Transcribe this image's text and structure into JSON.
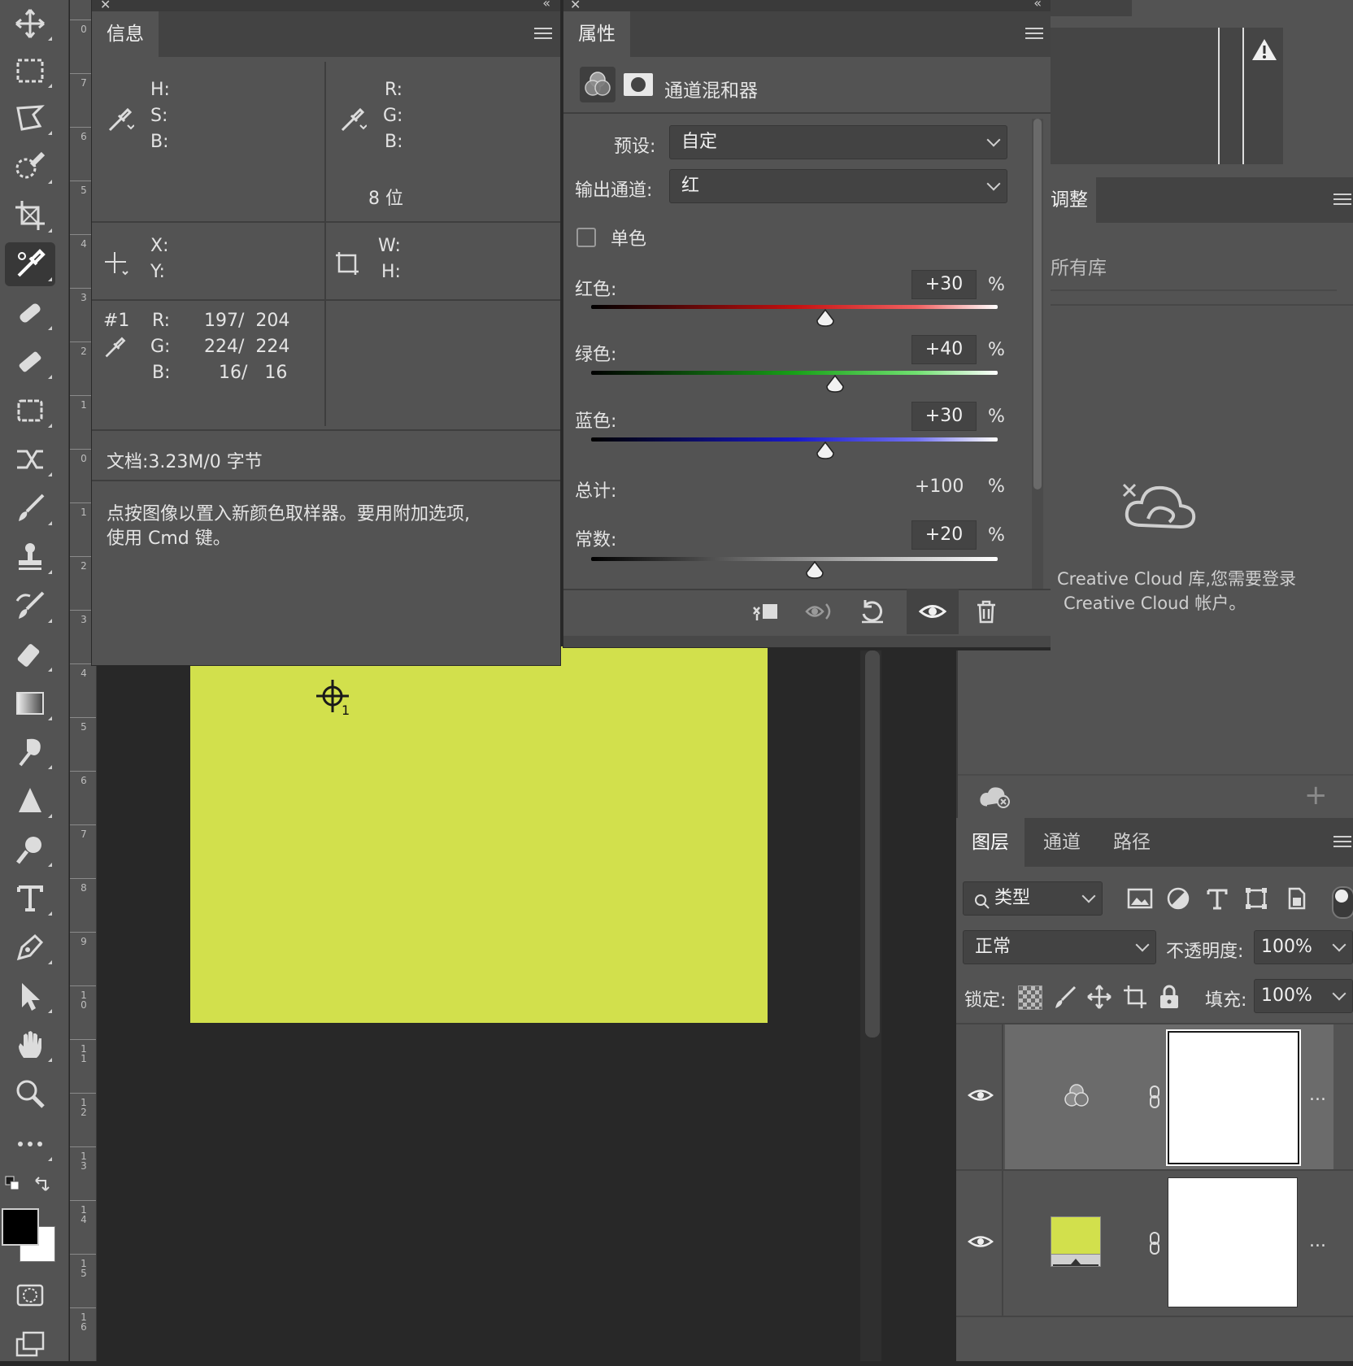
{
  "ruler": {
    "ticks": [
      "0",
      "7",
      "6",
      "5",
      "4",
      "3",
      "2",
      "1",
      "0",
      "1",
      "2",
      "3",
      "4",
      "5",
      "6",
      "7",
      "8",
      "9",
      "10",
      "11",
      "12",
      "13",
      "14",
      "15",
      "16"
    ]
  },
  "info_panel": {
    "tab": "信息",
    "hsb": {
      "h": "H:",
      "s": "S:",
      "b": "B:"
    },
    "rgb": {
      "r": "R:",
      "g": "G:",
      "b": "B:",
      "bits": "8 位"
    },
    "xy": {
      "x": "X:",
      "y": "Y:"
    },
    "wh": {
      "w": "W:",
      "h": "H:"
    },
    "sampler": {
      "id": "#1",
      "r_label": "R:",
      "r_value": "197/  204",
      "g_label": "G:",
      "g_value": "224/  224",
      "b_label": "B:",
      "b_value": "16/   16"
    },
    "doc": "文档:3.23M/0 字节",
    "hint_line1": "点按图像以置入新颜色取样器。要用附加选项,",
    "hint_line2": "使用 Cmd 键。"
  },
  "properties_panel": {
    "tab": "属性",
    "title": "通道混和器",
    "preset_label": "预设:",
    "preset_value": "自定",
    "output_label": "输出通道:",
    "output_value": "红",
    "mono_label": "单色",
    "mono_checked": false,
    "red_label": "红色:",
    "red_value": "+30",
    "green_label": "绿色:",
    "green_value": "+40",
    "blue_label": "蓝色:",
    "blue_value": "+30",
    "total_label": "总计:",
    "total_value": "+100",
    "const_label": "常数:",
    "const_value": "+20",
    "percent": "%",
    "sliders": {
      "red": 30,
      "green": 40,
      "blue": 30,
      "constant": 20
    }
  },
  "library_panel": {
    "tab_partial": "调整",
    "dropdown_partial": "所有库",
    "message_line1": "Creative Cloud 库,您需要登录",
    "message_line2": "Creative Cloud 帐户。"
  },
  "layers_panel": {
    "tabs": [
      "图层",
      "通道",
      "路径"
    ],
    "filter": "类型",
    "blend_mode": "正常",
    "opacity_label": "不透明度:",
    "opacity_value": "100%",
    "lock_label": "锁定:",
    "fill_label": "填充:",
    "fill_value": "100%",
    "layer2_more": "...",
    "layer1_more": "...",
    "swatch_color": "#d2e04c"
  },
  "canvas": {
    "color": "#d2e04c",
    "sampler_number": "1"
  },
  "colors": {
    "foreground": "#000000",
    "background": "#ffffff"
  }
}
